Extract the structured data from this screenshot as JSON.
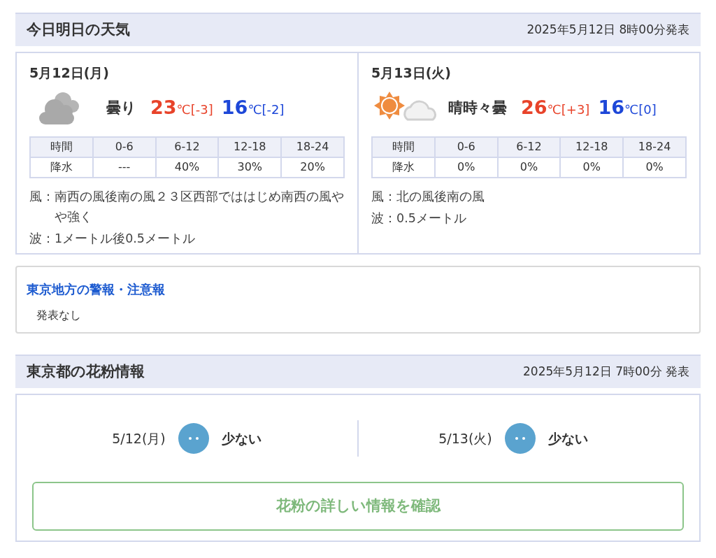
{
  "forecast": {
    "title": "今日明日の天気",
    "issued": "2025年5月12日 8時00分発表",
    "days": [
      {
        "date": "5月12日(月)",
        "kind": "cloudy",
        "weather": "曇り",
        "high": "23",
        "high_unit": "℃",
        "high_diff": "[-3]",
        "low": "16",
        "low_unit": "℃",
        "low_diff": "[-2]",
        "table_header": [
          "時間",
          "0-6",
          "6-12",
          "12-18",
          "18-24"
        ],
        "table_row": [
          "降水",
          "---",
          "40%",
          "30%",
          "20%"
        ],
        "wind_label": "風：",
        "wind": "南西の風後南の風２３区西部でははじめ南西の風やや強く",
        "wave_label": "波：",
        "wave": "1メートル後0.5メートル"
      },
      {
        "date": "5月13日(火)",
        "kind": "sunny_cloudy",
        "weather": "晴時々曇",
        "high": "26",
        "high_unit": "℃",
        "high_diff": "[+3]",
        "low": "16",
        "low_unit": "℃",
        "low_diff": "[0]",
        "table_header": [
          "時間",
          "0-6",
          "6-12",
          "12-18",
          "18-24"
        ],
        "table_row": [
          "降水",
          "0%",
          "0%",
          "0%",
          "0%"
        ],
        "wind_label": "風：",
        "wind": "北の風後南の風",
        "wave_label": "波：",
        "wave": "0.5メートル"
      }
    ]
  },
  "warnings": {
    "title": "東京地方の警報・注意報",
    "body": "発表なし"
  },
  "pollen": {
    "title": "東京都の花粉情報",
    "issued": "2025年5月12日 7時00分 発表",
    "days": [
      {
        "date": "5/12(月)",
        "kind": "few",
        "level": "少ない"
      },
      {
        "date": "5/13(火)",
        "kind": "few",
        "level": "少ない"
      }
    ],
    "button": "花粉の詳しい情報を確認"
  }
}
